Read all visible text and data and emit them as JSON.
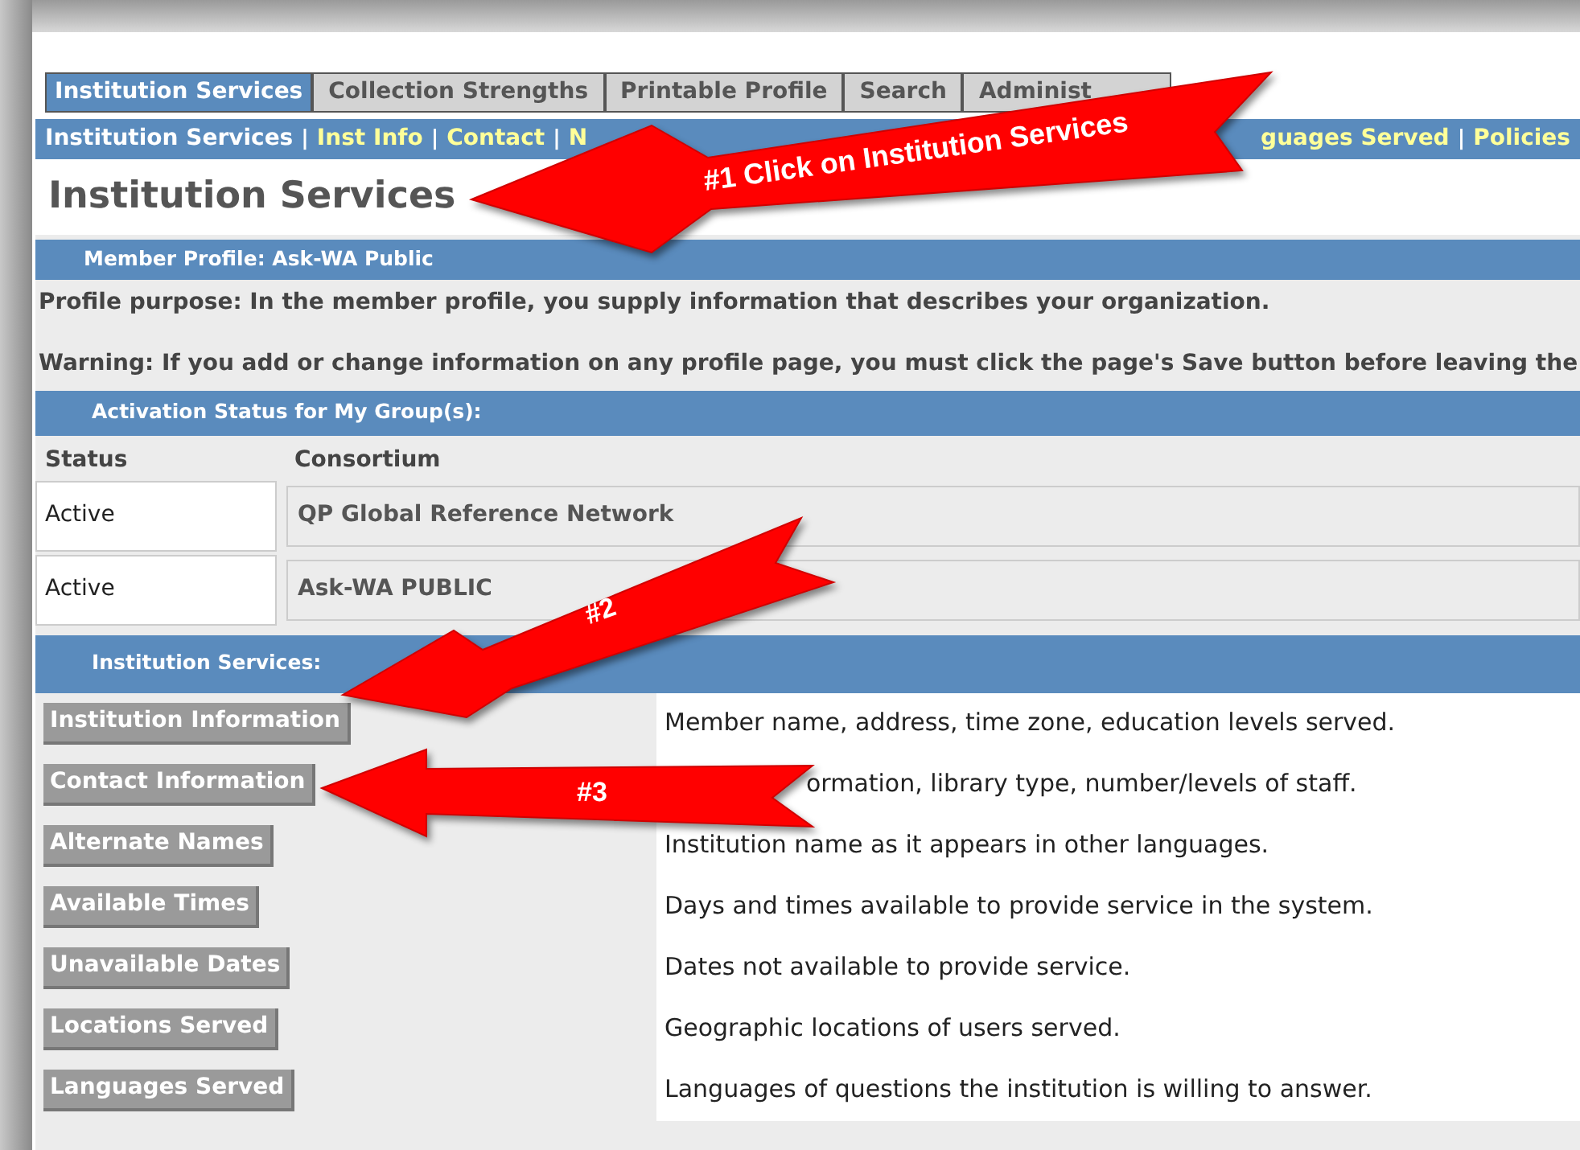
{
  "tabs": [
    {
      "label": "Institution Services",
      "selected": true
    },
    {
      "label": "Collection Strengths",
      "selected": false
    },
    {
      "label": "Printable Profile",
      "selected": false
    },
    {
      "label": "Search",
      "selected": false
    },
    {
      "label": "Administ",
      "selected": false
    }
  ],
  "subnav_separator": "|",
  "subnav": [
    {
      "label": "Institution Services",
      "kind": "current"
    },
    {
      "label": "Inst Info",
      "kind": "link"
    },
    {
      "label": "Contact",
      "kind": "link"
    },
    {
      "label": "N",
      "kind": "link"
    },
    {
      "label": "guages Served",
      "kind": "covered"
    },
    {
      "label": "Policies",
      "kind": "link"
    }
  ],
  "heading": "Institution Services",
  "member_bar": "Member Profile: Ask-WA Public",
  "purpose": "Profile purpose: In the member profile, you supply information that describes your organization.",
  "warning": "Warning: If you add or change information on any profile page, you must click the page's Save button before leaving the",
  "activation": {
    "title": "Activation Status for My Group(s):",
    "columns": [
      "Status",
      "Consortium"
    ],
    "rows": [
      {
        "status": "Active",
        "consortium": "QP Global Reference Network"
      },
      {
        "status": "Active",
        "consortium": "Ask-WA PUBLIC"
      }
    ]
  },
  "services": {
    "title": "Institution Services:",
    "rows": [
      {
        "button": "Institution Information",
        "description": "Member name, address, time zone, education levels served.",
        "covered": false
      },
      {
        "button": "Contact Information",
        "description": "ormation, library type, number/levels of staff.",
        "covered": true
      },
      {
        "button": "Alternate Names",
        "description": "Institution name as it appears in other languages.",
        "covered": false
      },
      {
        "button": "Available Times",
        "description": "Days and times available to provide service in the system.",
        "covered": false
      },
      {
        "button": "Unavailable Dates",
        "description": "Dates not available to provide service.",
        "covered": false
      },
      {
        "button": "Locations Served",
        "description": "Geographic locations of users served.",
        "covered": false
      },
      {
        "button": "Languages Served",
        "description": "Languages of questions the institution is willing to answer.",
        "covered": false
      }
    ]
  },
  "annotations": [
    {
      "kind": "callout-1",
      "text": "#1 Click on Institution Services"
    },
    {
      "kind": "callout-2",
      "text": "#2"
    },
    {
      "kind": "callout-3",
      "text": "#3"
    }
  ]
}
